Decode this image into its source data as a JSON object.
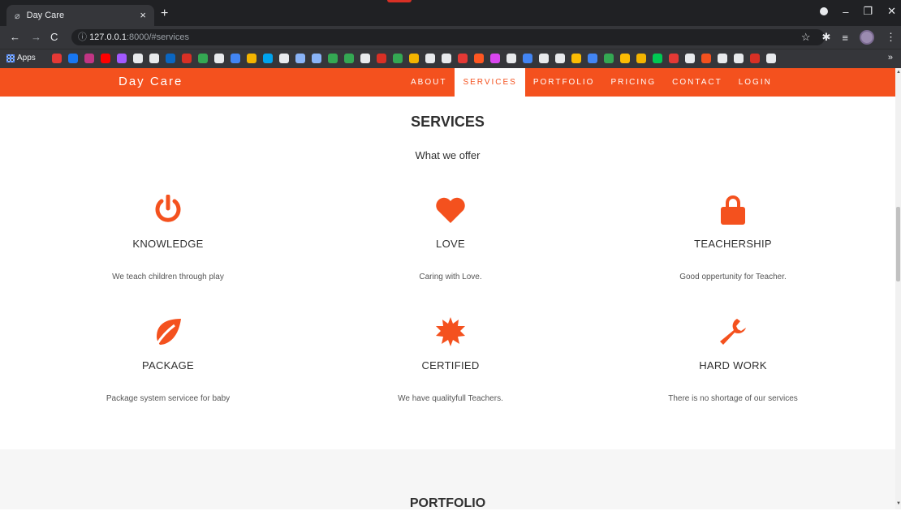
{
  "browser": {
    "tab_title": "Day Care",
    "tab_close": "×",
    "new_tab": "+",
    "url_host": "127.0.0.1",
    "url_path": ":8000/#services",
    "apps_label": "Apps",
    "bookmarks_more": "»",
    "bookmark_colors": [
      "#e53935",
      "#1877f2",
      "#c13584",
      "#ff0000",
      "#a259ff",
      "#e8eaed",
      "#e8eaed",
      "#0a66c2",
      "#d93025",
      "#34a853",
      "#e8eaed",
      "#4285f4",
      "#f4b400",
      "#00a4ef",
      "#e8eaed",
      "#8ab4f8",
      "#8ab4f8",
      "#34a853",
      "#34a853",
      "#e8eaed",
      "#d93025",
      "#34a853",
      "#f4b400",
      "#e8eaed",
      "#e8eaed",
      "#e53935",
      "#ff5722",
      "#d946ef",
      "#e8eaed",
      "#4285f4",
      "#e8eaed",
      "#e8eaed",
      "#fbbc04",
      "#4285f4",
      "#34a853",
      "#fbbc04",
      "#f4b400",
      "#00c853",
      "#e53935",
      "#e8eaed",
      "#f4511e",
      "#e8eaed",
      "#e8eaed",
      "#d93025",
      "#e8eaed"
    ]
  },
  "site": {
    "brand": "Day Care",
    "accent_color": "#f4511e",
    "menu": [
      {
        "label": "ABOUT"
      },
      {
        "label": "SERVICES",
        "active": true
      },
      {
        "label": "PORTFOLIO"
      },
      {
        "label": "PRICING"
      },
      {
        "label": "CONTACT"
      },
      {
        "label": "LOGIN"
      }
    ]
  },
  "services": {
    "title": "SERVICES",
    "subtitle": "What we offer",
    "items": [
      {
        "icon": "power-icon",
        "name": "KNOWLEDGE",
        "desc": "We teach children through play"
      },
      {
        "icon": "heart-icon",
        "name": "LOVE",
        "desc": "Caring with Love."
      },
      {
        "icon": "lock-icon",
        "name": "TEACHERSHIP",
        "desc": "Good oppertunity for Teacher."
      },
      {
        "icon": "leaf-icon",
        "name": "PACKAGE",
        "desc": "Package system servicee for baby"
      },
      {
        "icon": "certificate-icon",
        "name": "CERTIFIED",
        "desc": "We have qualityfull Teachers."
      },
      {
        "icon": "wrench-icon",
        "name": "HARD WORK",
        "desc": "There is no shortage of our services"
      }
    ]
  },
  "portfolio": {
    "title": "PORTFOLIO"
  }
}
